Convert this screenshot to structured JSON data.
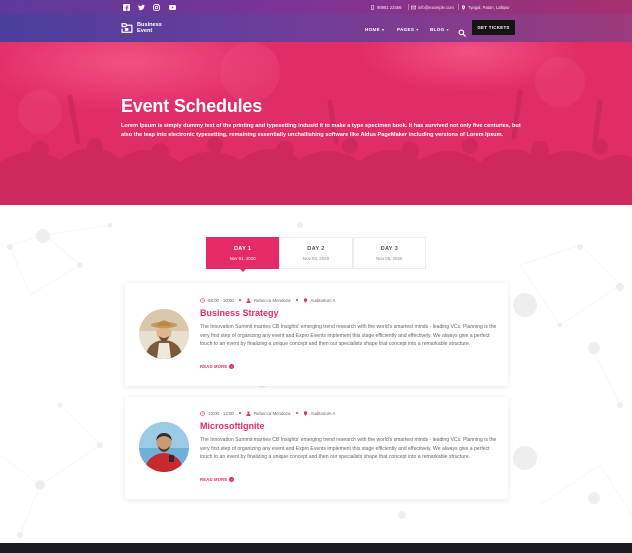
{
  "topbar": {
    "social_icons": [
      "facebook-icon",
      "twitter-icon",
      "instagram-icon",
      "youtube-icon"
    ],
    "phone": "98981 23456",
    "email": "info@example.com",
    "address": "Tyagal, Patan, Lalitpur"
  },
  "nav": {
    "logo_line1": "Business",
    "logo_line2": "Event",
    "menu": [
      {
        "label": "HOME"
      },
      {
        "label": "PAGES"
      },
      {
        "label": "BLOG"
      }
    ],
    "cta": "GET TICKETS"
  },
  "hero": {
    "title": "Event Schedules",
    "text": "Lorem Ipsum is simply dummy text of the printing and typesetting indusid it to make a type specimen book. It has survived not only five centuries, but also the leap into electronic typesetting, remaining essentially unchallishing software like Aldus PageMaker including versions of Lorem Ipsum."
  },
  "tabs": [
    {
      "day": "DAY 1",
      "date": "Nov 01, 2020",
      "active": true
    },
    {
      "day": "DAY 2",
      "date": "Nov 03, 2020",
      "active": false
    },
    {
      "day": "DAY 3",
      "date": "Nov 05, 2020",
      "active": false
    }
  ],
  "sessions": [
    {
      "time": "08:00 - 10:00",
      "speaker": "Rebecca Mendoza",
      "location": "Auditorium A",
      "title": "Business Strategy",
      "description": "The Innovation Summit marries CB Insights' emerging trend research with the world's smartest minds - leading VCs. Planning is the very first step of organizing any event and Expro Events implement this stage efficiently and effectively. We always give a perfect touch to an event by finalizing a unique concept and then our specialists shape that concept into a remarkable structure.",
      "read_more": "READ MORE"
    },
    {
      "time": "10:00 - 13:00",
      "speaker": "Rebecca Mendoza",
      "location": "Auditorium A",
      "title": "MicrosoftIgnite",
      "description": "The Innovation Summit marries CB Insights' emerging trend research with the world's smartest minds - leading VCs. Planning is the very first step of organizing any event and Expro Events implement this stage efficiently and effectively. We always give a perfect touch to an event by finalizing a unique concept and then our specialists shape that concept into a remarkable structure.",
      "read_more": "READ MORE"
    }
  ],
  "colors": {
    "accent": "#e42a67",
    "dark": "#141414"
  }
}
